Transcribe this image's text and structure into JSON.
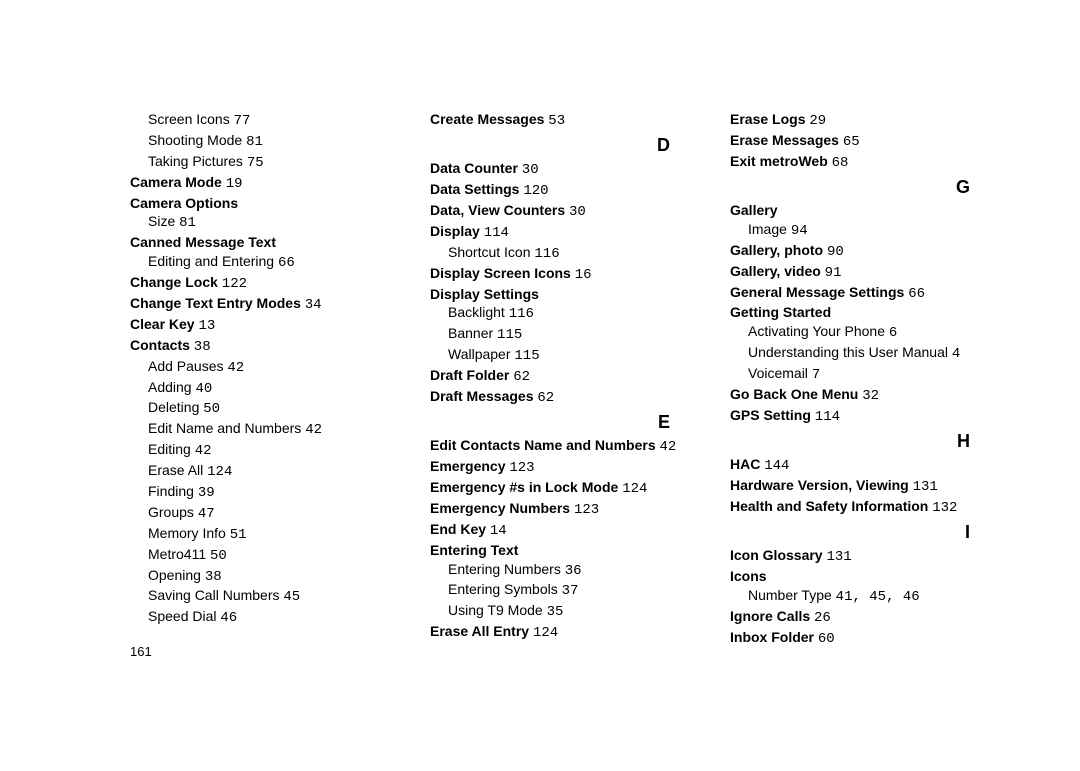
{
  "pageNumber": "161",
  "col1": [
    {
      "t": "sub",
      "label": "Screen Icons",
      "page": "77"
    },
    {
      "t": "sub",
      "label": "Shooting Mode",
      "page": "81"
    },
    {
      "t": "sub",
      "label": "Taking Pictures",
      "page": "75"
    },
    {
      "t": "bold",
      "label": "Camera Mode",
      "page": "19"
    },
    {
      "t": "bold",
      "label": "Camera Options",
      "page": ""
    },
    {
      "t": "sub",
      "label": "Size",
      "page": "81"
    },
    {
      "t": "bold",
      "label": "Canned Message Text",
      "page": ""
    },
    {
      "t": "sub",
      "label": "Editing and Entering",
      "page": "66"
    },
    {
      "t": "bold",
      "label": "Change Lock",
      "page": "122"
    },
    {
      "t": "bold",
      "label": "Change Text Entry Modes",
      "page": "34"
    },
    {
      "t": "bold",
      "label": "Clear Key",
      "page": "13"
    },
    {
      "t": "bold",
      "label": "Contacts",
      "page": "38"
    },
    {
      "t": "sub",
      "label": "Add Pauses",
      "page": "42"
    },
    {
      "t": "sub",
      "label": "Adding",
      "page": "40"
    },
    {
      "t": "sub",
      "label": "Deleting",
      "page": "50"
    },
    {
      "t": "sub",
      "label": "Edit Name and Numbers",
      "page": "42"
    },
    {
      "t": "sub",
      "label": "Editing",
      "page": "42"
    },
    {
      "t": "sub",
      "label": "Erase All",
      "page": "124"
    },
    {
      "t": "sub",
      "label": "Finding",
      "page": "39"
    },
    {
      "t": "sub",
      "label": "Groups",
      "page": "47"
    },
    {
      "t": "sub",
      "label": "Memory Info",
      "page": "51"
    },
    {
      "t": "sub",
      "label": "Metro411",
      "page": "50"
    },
    {
      "t": "sub",
      "label": "Opening",
      "page": "38"
    },
    {
      "t": "sub",
      "label": "Saving Call Numbers",
      "page": "45"
    },
    {
      "t": "sub",
      "label": "Speed Dial",
      "page": "46"
    }
  ],
  "col2": [
    {
      "t": "bold",
      "label": "Create Messages",
      "page": "53"
    },
    {
      "t": "letter",
      "label": "D"
    },
    {
      "t": "bold",
      "label": "Data Counter",
      "page": "30"
    },
    {
      "t": "bold",
      "label": "Data Settings",
      "page": "120"
    },
    {
      "t": "bold",
      "label": "Data, View Counters",
      "page": "30"
    },
    {
      "t": "bold",
      "label": "Display",
      "page": "114"
    },
    {
      "t": "sub",
      "label": "Shortcut Icon",
      "page": "116"
    },
    {
      "t": "bold",
      "label": "Display Screen Icons",
      "page": "16"
    },
    {
      "t": "bold",
      "label": "Display Settings",
      "page": ""
    },
    {
      "t": "sub",
      "label": "Backlight",
      "page": "116"
    },
    {
      "t": "sub",
      "label": "Banner",
      "page": "115"
    },
    {
      "t": "sub",
      "label": "Wallpaper",
      "page": "115"
    },
    {
      "t": "bold",
      "label": "Draft Folder",
      "page": "62"
    },
    {
      "t": "bold",
      "label": "Draft Messages",
      "page": "62"
    },
    {
      "t": "letter",
      "label": "E"
    },
    {
      "t": "bold",
      "label": "Edit Contacts Name and Numbers",
      "page": "42"
    },
    {
      "t": "bold",
      "label": "Emergency",
      "page": "123"
    },
    {
      "t": "bold",
      "label": "Emergency #s in Lock Mode",
      "page": "124"
    },
    {
      "t": "bold",
      "label": "Emergency Numbers",
      "page": "123"
    },
    {
      "t": "bold",
      "label": "End Key",
      "page": "14"
    },
    {
      "t": "bold",
      "label": "Entering Text",
      "page": ""
    },
    {
      "t": "sub",
      "label": "Entering Numbers",
      "page": "36"
    },
    {
      "t": "sub",
      "label": "Entering Symbols",
      "page": "37"
    },
    {
      "t": "sub",
      "label": "Using T9 Mode",
      "page": "35"
    },
    {
      "t": "bold",
      "label": "Erase All Entry",
      "page": "124"
    }
  ],
  "col3": [
    {
      "t": "bold",
      "label": "Erase Logs",
      "page": "29"
    },
    {
      "t": "bold",
      "label": "Erase Messages",
      "page": "65"
    },
    {
      "t": "bold",
      "label": "Exit metroWeb",
      "page": "68"
    },
    {
      "t": "letter",
      "label": "G"
    },
    {
      "t": "bold",
      "label": "Gallery",
      "page": ""
    },
    {
      "t": "sub",
      "label": "Image",
      "page": "94"
    },
    {
      "t": "bold",
      "label": "Gallery, photo",
      "page": "90"
    },
    {
      "t": "bold",
      "label": "Gallery, video",
      "page": "91"
    },
    {
      "t": "bold",
      "label": "General Message Settings",
      "page": "66"
    },
    {
      "t": "bold",
      "label": "Getting Started",
      "page": ""
    },
    {
      "t": "sub",
      "label": "Activating Your Phone",
      "page": "6"
    },
    {
      "t": "sub",
      "label": "Understanding this User Manual",
      "page": "4"
    },
    {
      "t": "sub",
      "label": "Voicemail",
      "page": "7"
    },
    {
      "t": "bold",
      "label": "Go Back One Menu",
      "page": "32"
    },
    {
      "t": "bold",
      "label": "GPS Setting",
      "page": "114"
    },
    {
      "t": "letter",
      "label": "H"
    },
    {
      "t": "bold",
      "label": "HAC",
      "page": "144"
    },
    {
      "t": "bold",
      "label": "Hardware Version, Viewing",
      "page": "131"
    },
    {
      "t": "bold",
      "label": "Health and Safety Information",
      "page": "132"
    },
    {
      "t": "letter",
      "label": "I"
    },
    {
      "t": "bold",
      "label": "Icon Glossary",
      "page": "131"
    },
    {
      "t": "bold",
      "label": "Icons",
      "page": ""
    },
    {
      "t": "sub",
      "label": "Number Type",
      "page": "41, 45, 46"
    },
    {
      "t": "bold",
      "label": "Ignore Calls",
      "page": "26"
    },
    {
      "t": "bold",
      "label": "Inbox Folder",
      "page": "60"
    }
  ]
}
